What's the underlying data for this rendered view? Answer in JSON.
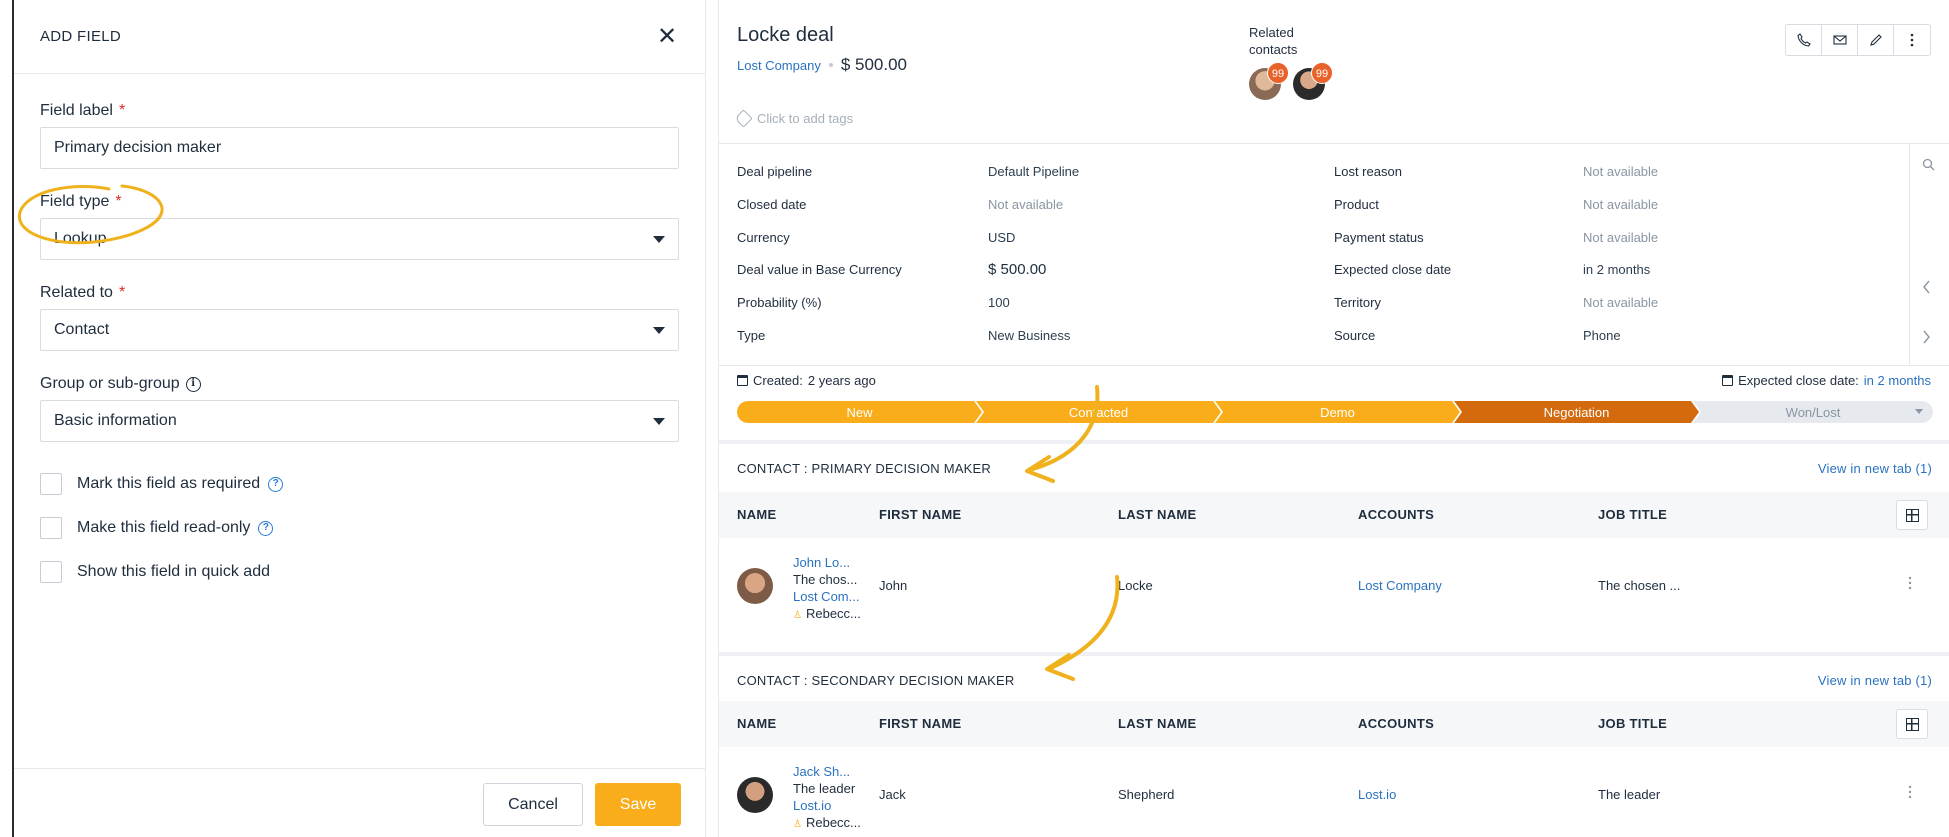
{
  "add_field": {
    "title": "ADD FIELD",
    "close_glyph": "✕",
    "field_label": {
      "label": "Field label",
      "required": "*",
      "value": "Primary decision maker"
    },
    "field_type": {
      "label": "Field type",
      "required": "*",
      "value": "Lookup"
    },
    "related_to": {
      "label": "Related to",
      "required": "*",
      "value": "Contact"
    },
    "group": {
      "label": "Group or sub-group",
      "value": "Basic information",
      "info_glyph": "i"
    },
    "checkboxes": [
      {
        "label": "Mark this field as required",
        "help": true
      },
      {
        "label": "Make this field read-only",
        "help": true
      },
      {
        "label": "Show this field in quick add",
        "help": false
      }
    ],
    "help_glyph": "?",
    "cancel_label": "Cancel",
    "save_label": "Save"
  },
  "deal": {
    "title": "Locke deal",
    "company": "Lost Company",
    "amount": "$ 500.00",
    "tags_placeholder": "Click to add tags",
    "related_contacts_label": "Related contacts",
    "avatar_badges": [
      "99",
      "99"
    ],
    "toolbar_icons": [
      "phone-icon",
      "mail-icon",
      "edit-icon",
      "more-icon"
    ],
    "fields_left": [
      {
        "label": "Deal pipeline",
        "value": "Default Pipeline"
      },
      {
        "label": "Closed date",
        "value": "Not available"
      },
      {
        "label": "Currency",
        "value": "USD"
      },
      {
        "label": "Deal value in Base Currency",
        "value": "$ 500.00"
      },
      {
        "label": "Probability (%)",
        "value": "100"
      },
      {
        "label": "Type",
        "value": "New Business"
      }
    ],
    "fields_right": [
      {
        "label": "Lost reason",
        "value": "Not available"
      },
      {
        "label": "Product",
        "value": "Not available"
      },
      {
        "label": "Payment status",
        "value": "Not available"
      },
      {
        "label": "Expected close date",
        "value": "in 2 months"
      },
      {
        "label": "Territory",
        "value": "Not available"
      },
      {
        "label": "Source",
        "value": "Phone"
      }
    ],
    "created_label": "Created:",
    "created_value": "2 years ago",
    "expected_label": "Expected close date:",
    "expected_value": "in 2 months",
    "stages": [
      "New",
      "Contacted",
      "Demo",
      "Negotiation",
      "Won/Lost"
    ],
    "stage_colors": {
      "done": "#f9ad1b",
      "current": "#d46a0e",
      "pending": "#e6e9ed"
    }
  },
  "sections": [
    {
      "title": "CONTACT : PRIMARY DECISION MAKER",
      "view_link": "View in new tab (1)",
      "columns": [
        "NAME",
        "FIRST NAME",
        "LAST NAME",
        "ACCOUNTS",
        "JOB TITLE"
      ],
      "row": {
        "name": "John Lo...",
        "title_line": "The chos...",
        "company_line": "Lost Com...",
        "owner": "Rebecc...",
        "first_name": "John",
        "last_name": "Locke",
        "account": "Lost Company",
        "job_title": "The chosen ..."
      }
    },
    {
      "title": "CONTACT : SECONDARY DECISION MAKER",
      "view_link": "View in new tab (1)",
      "columns": [
        "NAME",
        "FIRST NAME",
        "LAST NAME",
        "ACCOUNTS",
        "JOB TITLE"
      ],
      "row": {
        "name": "Jack Sh...",
        "title_line": "The leader",
        "company_line": "Lost.io",
        "owner": "Rebecc...",
        "first_name": "Jack",
        "last_name": "Shepherd",
        "account": "Lost.io",
        "job_title": "The leader"
      }
    }
  ],
  "colors": {
    "accent": "#f9ad1b",
    "link": "#2a72c0",
    "annotation": "#efb21d"
  }
}
